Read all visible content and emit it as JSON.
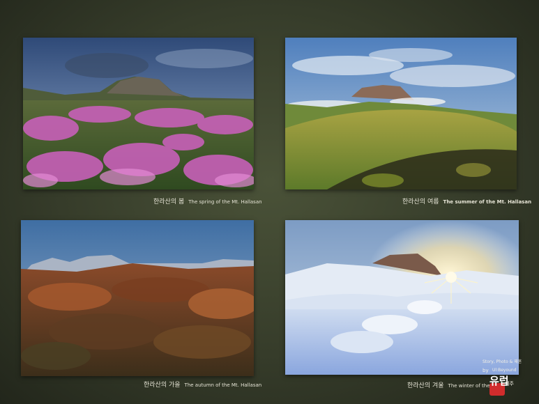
{
  "photos": [
    {
      "season": "spring",
      "caption_ko": "한라산의 봄",
      "caption_en": "The spring of the Mt. Hallasan"
    },
    {
      "season": "summer",
      "caption_ko": "한라산의 여름",
      "caption_en": "The summer of the Mt. Hallasan"
    },
    {
      "season": "autumn",
      "caption_ko": "한라산의 가을",
      "caption_en": "The autumn of the Mt. Hallasan"
    },
    {
      "season": "winter",
      "caption_ko": "한라산의 겨울",
      "caption_en": "The winter of the Mt"
    }
  ],
  "watermark": {
    "line1": "Story, Photo & 재혼",
    "by": "by",
    "handle": "Ul:Beyound",
    "name": "유럽",
    "region": "제주"
  },
  "colors": {
    "wall": "#3f4631",
    "caption_text": "#e6e4d6",
    "stamp": "#d02c2c"
  }
}
